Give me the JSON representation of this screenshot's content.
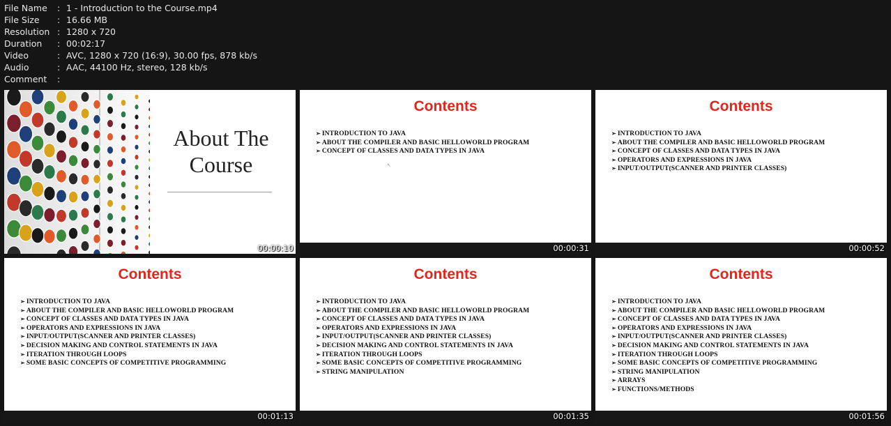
{
  "file_info": [
    {
      "label": "File Name",
      "value": "1 - Introduction to the Course.mp4"
    },
    {
      "label": "File Size",
      "value": "16.66 MB"
    },
    {
      "label": "Resolution",
      "value": "1280 x 720"
    },
    {
      "label": "Duration",
      "value": "00:02:17"
    },
    {
      "label": "Video",
      "value": "AVC, 1280 x 720 (16:9), 30.00 fps, 878 kb/s"
    },
    {
      "label": "Audio",
      "value": "AAC, 44100 Hz, stereo, 128 kb/s"
    },
    {
      "label": "Comment",
      "value": ""
    }
  ],
  "separator": ":",
  "slide_title": "Contents",
  "bullet": "➢",
  "about_slide": {
    "line1": "About The",
    "line2": "Course",
    "timestamp": "00:00:10"
  },
  "thumbnails": [
    {
      "timestamp": "00:00:31",
      "items": [
        "INTRODUCTION TO JAVA",
        "ABOUT THE COMPILER AND BASIC HELLOWORLD PROGRAM",
        "CONCEPT OF CLASSES AND DATA TYPES IN JAVA"
      ]
    },
    {
      "timestamp": "00:00:52",
      "items": [
        "INTRODUCTION TO JAVA",
        "ABOUT THE COMPILER AND BASIC HELLOWORLD PROGRAM",
        "CONCEPT OF CLASSES AND DATA TYPES IN JAVA",
        "OPERATORS AND EXPRESSIONS IN JAVA",
        "INPUT/OUTPUT(SCANNER AND PRINTER CLASSES)"
      ]
    },
    {
      "timestamp": "00:01:13",
      "items": [
        "INTRODUCTION TO JAVA",
        "ABOUT THE COMPILER AND BASIC HELLOWORLD PROGRAM",
        "CONCEPT OF CLASSES AND DATA TYPES IN JAVA",
        "OPERATORS AND EXPRESSIONS IN JAVA",
        "INPUT/OUTPUT(SCANNER AND PRINTER CLASSES)",
        "DECISION MAKING AND CONTROL STATEMENTS IN JAVA",
        "ITERATION THROUGH LOOPS",
        "SOME BASIC CONCEPTS OF COMPETITIVE PROGRAMMING"
      ]
    },
    {
      "timestamp": "00:01:35",
      "items": [
        "INTRODUCTION TO JAVA",
        "ABOUT THE COMPILER AND BASIC HELLOWORLD PROGRAM",
        "CONCEPT OF CLASSES AND DATA TYPES IN JAVA",
        "OPERATORS AND EXPRESSIONS IN JAVA",
        "INPUT/OUTPUT(SCANNER AND PRINTER CLASSES)",
        "DECISION MAKING AND CONTROL STATEMENTS IN JAVA",
        "ITERATION THROUGH LOOPS",
        "SOME BASIC CONCEPTS OF COMPETITIVE PROGRAMMING",
        "STRING MANIPULATION"
      ]
    },
    {
      "timestamp": "00:01:56",
      "items": [
        "INTRODUCTION TO JAVA",
        "ABOUT THE COMPILER AND BASIC HELLOWORLD PROGRAM",
        "CONCEPT OF CLASSES AND DATA TYPES IN JAVA",
        "OPERATORS AND EXPRESSIONS IN JAVA",
        "INPUT/OUTPUT(SCANNER AND PRINTER CLASSES)",
        "DECISION MAKING AND CONTROL STATEMENTS IN JAVA",
        "ITERATION THROUGH LOOPS",
        "SOME BASIC CONCEPTS OF COMPETITIVE PROGRAMMING",
        "STRING MANIPULATION",
        "ARRAYS",
        "FUNCTIONS/METHODS"
      ]
    }
  ],
  "colors": {
    "title_red": "#e0261d",
    "background": "#151515"
  }
}
